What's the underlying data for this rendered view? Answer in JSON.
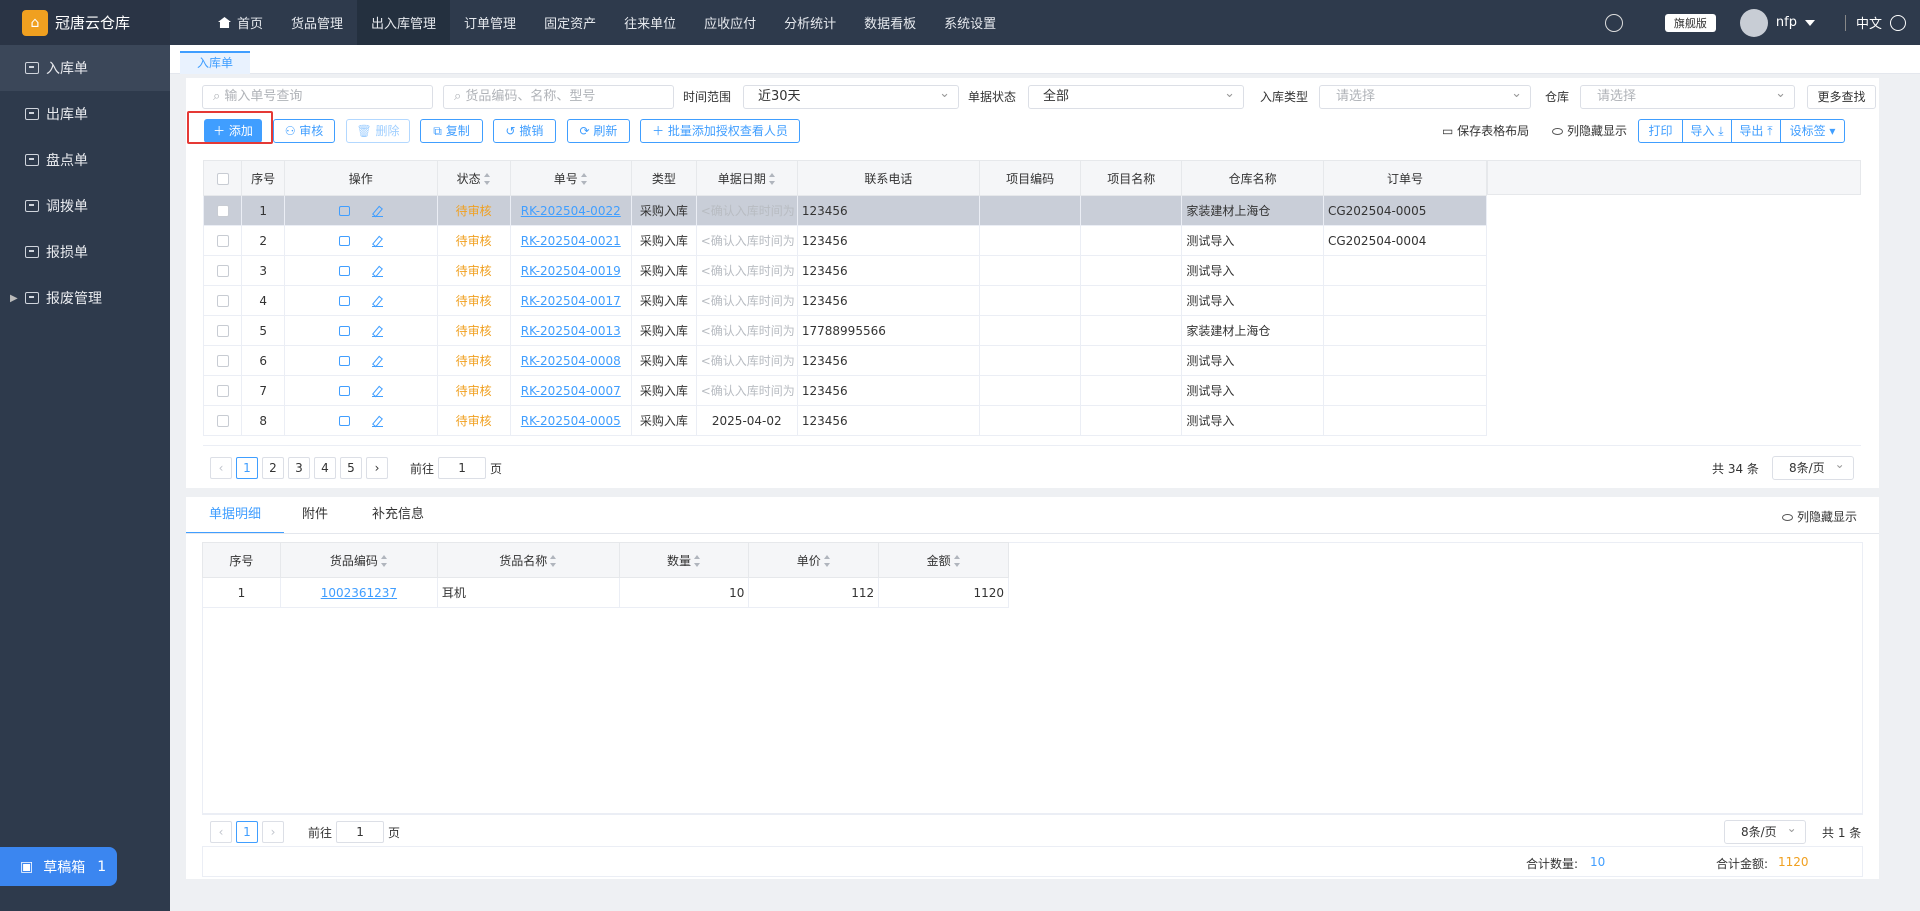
{
  "app": {
    "name": "冠唐云仓库",
    "edition": "旗舰版",
    "user": "nfp",
    "language": "中文",
    "accent": "#409eff",
    "highlight": "#e53935"
  },
  "top_nav": [
    "首页",
    "货品管理",
    "出入库管理",
    "订单管理",
    "固定资产",
    "往来单位",
    "应收应付",
    "分析统计",
    "数据看板",
    "系统设置"
  ],
  "sidebar": {
    "items": [
      "入库单",
      "出库单",
      "盘点单",
      "调拨单",
      "报损单",
      "报废管理"
    ],
    "draft_label": "草稿箱",
    "draft_count": "1"
  },
  "page_tab": "入库单",
  "filters": {
    "order_no_placeholder": "输入单号查询",
    "goods_placeholder": "货品编码、名称、型号",
    "time_label": "时间范围",
    "time_value": "近30天",
    "status_label": "单据状态",
    "status_value": "全部",
    "type_label": "入库类型",
    "type_placeholder": "请选择",
    "warehouse_label": "仓库",
    "warehouse_placeholder": "请选择",
    "more": "更多查找"
  },
  "toolbar": {
    "add": "添加",
    "audit": "审核",
    "delete": "删除",
    "copy": "复制",
    "revoke": "撤销",
    "refresh": "刷新",
    "batch_auth": "批量添加授权查看人员",
    "save_layout": "保存表格布局",
    "col_hide": "列隐藏显示",
    "print": "打印",
    "import": "导入",
    "export": "导出",
    "set_tag": "设标签"
  },
  "table": {
    "headers": [
      "序号",
      "操作",
      "状态",
      "单号",
      "类型",
      "单据日期",
      "联系电话",
      "项目编码",
      "项目名称",
      "仓库名称",
      "订单号"
    ],
    "rows": [
      {
        "no": "1",
        "status": "待审核",
        "id": "RK-202504-0022",
        "type": "采购入库",
        "date": "<确认入库时间为",
        "phone": "123456",
        "pcode": "",
        "pname": "",
        "wh": "家装建材上海仓",
        "order": "CG202504-0005"
      },
      {
        "no": "2",
        "status": "待审核",
        "id": "RK-202504-0021",
        "type": "采购入库",
        "date": "<确认入库时间为",
        "phone": "123456",
        "pcode": "",
        "pname": "",
        "wh": "测试导入",
        "order": "CG202504-0004"
      },
      {
        "no": "3",
        "status": "待审核",
        "id": "RK-202504-0019",
        "type": "采购入库",
        "date": "<确认入库时间为",
        "phone": "123456",
        "pcode": "",
        "pname": "",
        "wh": "测试导入",
        "order": ""
      },
      {
        "no": "4",
        "status": "待审核",
        "id": "RK-202504-0017",
        "type": "采购入库",
        "date": "<确认入库时间为",
        "phone": "123456",
        "pcode": "",
        "pname": "",
        "wh": "测试导入",
        "order": ""
      },
      {
        "no": "5",
        "status": "待审核",
        "id": "RK-202504-0013",
        "type": "采购入库",
        "date": "<确认入库时间为",
        "phone": "17788995566",
        "pcode": "",
        "pname": "",
        "wh": "家装建材上海仓",
        "order": ""
      },
      {
        "no": "6",
        "status": "待审核",
        "id": "RK-202504-0008",
        "type": "采购入库",
        "date": "<确认入库时间为",
        "phone": "123456",
        "pcode": "",
        "pname": "",
        "wh": "测试导入",
        "order": ""
      },
      {
        "no": "7",
        "status": "待审核",
        "id": "RK-202504-0007",
        "type": "采购入库",
        "date": "<确认入库时间为",
        "phone": "123456",
        "pcode": "",
        "pname": "",
        "wh": "测试导入",
        "order": ""
      },
      {
        "no": "8",
        "status": "待审核",
        "id": "RK-202504-0005",
        "type": "采购入库",
        "date": "2025-04-02",
        "phone": "123456",
        "pcode": "",
        "pname": "",
        "wh": "测试导入",
        "order": ""
      }
    ]
  },
  "pager": {
    "pages": [
      "1",
      "2",
      "3",
      "4",
      "5"
    ],
    "goto": "前往",
    "page_value": "1",
    "page_unit": "页",
    "total": "共 34 条",
    "size": "8条/页"
  },
  "detail": {
    "tabs": [
      "单据明细",
      "附件",
      "补充信息"
    ],
    "col_hide": "列隐藏显示",
    "headers": [
      "序号",
      "货品编码",
      "货品名称",
      "数量",
      "单价",
      "金额"
    ],
    "rows": [
      {
        "no": "1",
        "code": "1002361237",
        "name": "耳机",
        "qty": "10",
        "price": "112",
        "amount": "1120"
      }
    ],
    "pager": {
      "page": "1",
      "goto": "前往",
      "page_value": "1",
      "page_unit": "页",
      "size": "8条/页",
      "total": "共 1 条"
    },
    "sum_qty_label": "合计数量:",
    "sum_qty": "10",
    "sum_amount_label": "合计金额:",
    "sum_amount": "1120"
  }
}
